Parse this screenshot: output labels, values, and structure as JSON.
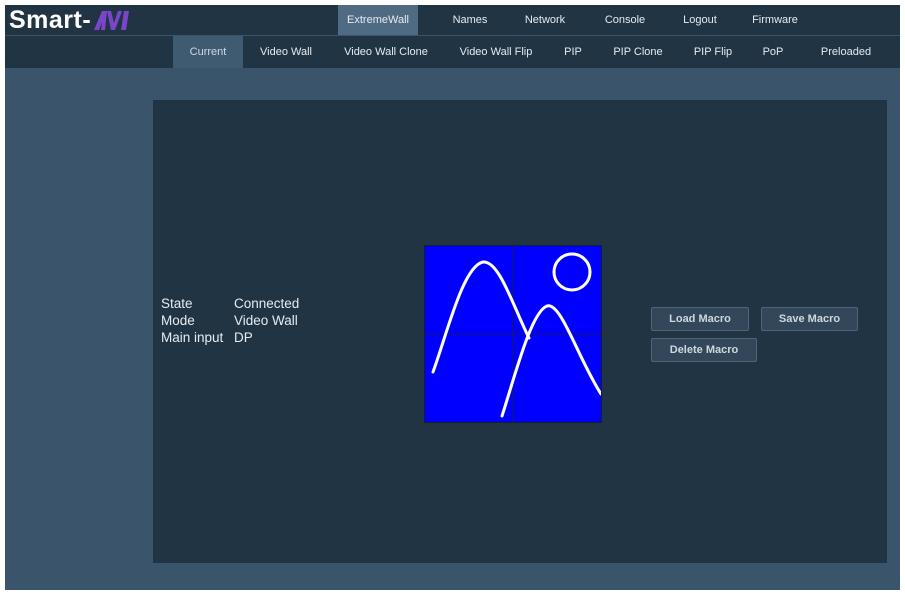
{
  "brand": {
    "name": "Smart-",
    "mark_color": "#7a45c8"
  },
  "main_nav": [
    {
      "label": "ExtremeWall",
      "active": true
    },
    {
      "label": "Names"
    },
    {
      "label": "Network"
    },
    {
      "label": "Console"
    },
    {
      "label": "Logout"
    },
    {
      "label": "Firmware"
    }
  ],
  "sub_nav": [
    {
      "label": "Current",
      "active": true
    },
    {
      "label": "Video Wall"
    },
    {
      "label": "Video Wall Clone"
    },
    {
      "label": "Video Wall Flip"
    },
    {
      "label": "PIP"
    },
    {
      "label": "PIP Clone"
    },
    {
      "label": "PIP Flip"
    },
    {
      "label": "PoP"
    },
    {
      "label": "Preloaded"
    }
  ],
  "status": [
    {
      "key": "State",
      "value": "Connected"
    },
    {
      "key": "Mode",
      "value": "Video Wall"
    },
    {
      "key": "Main input",
      "value": "DP"
    }
  ],
  "preview": {
    "icon": "video-wall-preview-icon",
    "background": "#0000ff",
    "stroke": "#ffffff"
  },
  "macros": {
    "load_label": "Load Macro",
    "save_label": "Save Macro",
    "delete_label": "Delete Macro"
  }
}
